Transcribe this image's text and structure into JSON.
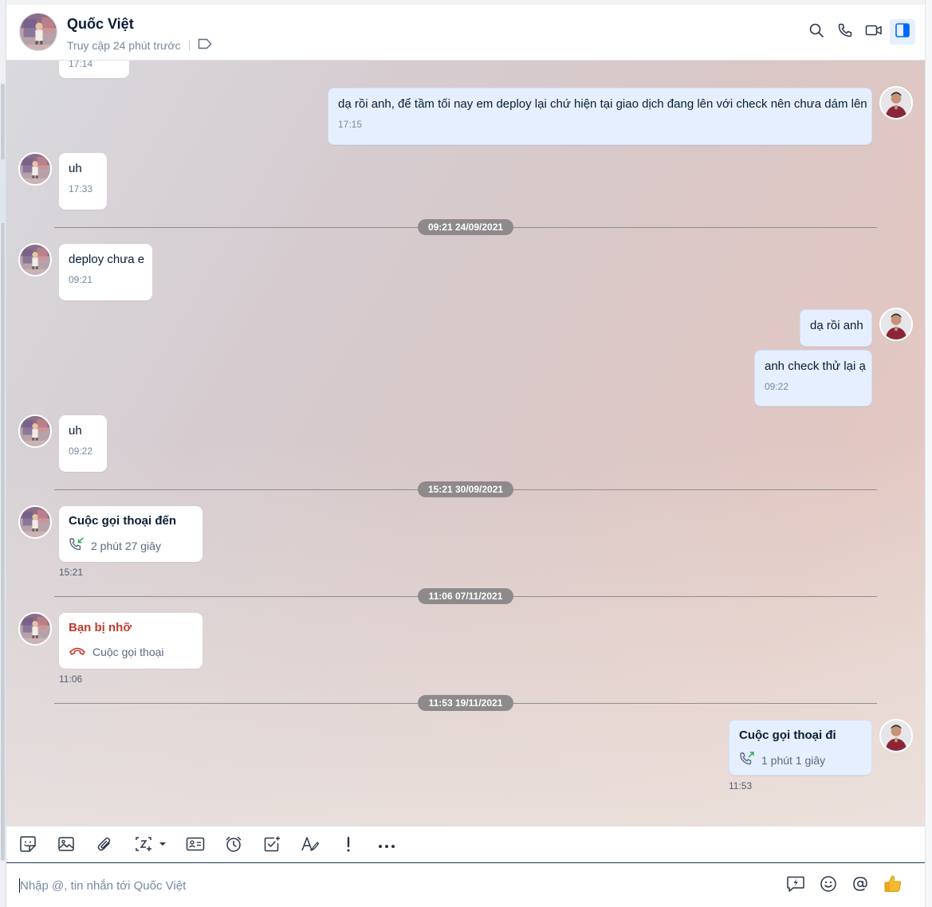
{
  "header": {
    "contact_name": "Quốc Việt",
    "status": "Truy cập 24 phút trước",
    "icons": [
      "tag-icon",
      "search-icon",
      "phone-icon",
      "video-icon",
      "sidebar-toggle-icon"
    ]
  },
  "messages": {
    "m0_time": "17:14",
    "m1_text": "dạ rồi anh, để tầm tối nay em deploy lại chứ hiện tại giao dịch đang lên với check nên chưa dám lên",
    "m1_time": "17:15",
    "m2_text": "uh",
    "m2_time": "17:33",
    "d1": "09:21 24/09/2021",
    "m3_text": "deploy chưa e",
    "m3_time": "09:21",
    "m4_text": "dạ rồi anh",
    "m5_text": "anh check thử lại ạ",
    "m5_time": "09:22",
    "m6_text": "uh",
    "m6_time": "09:22",
    "d2": "15:21 30/09/2021",
    "call1_title": "Cuộc gọi thoại đến",
    "call1_duration": "2 phút 27 giây",
    "call1_time": "15:21",
    "d3": "11:06 07/11/2021",
    "call2_title": "Bạn bị nhỡ",
    "call2_sub": "Cuộc gọi thoại",
    "call2_time": "11:06",
    "d4": "11:53 19/11/2021",
    "call3_title": "Cuộc gọi thoại đi",
    "call3_duration": "1 phút 1 giây",
    "call3_time": "11:53"
  },
  "toolbar": {
    "icons": [
      "sticker-icon",
      "image-icon",
      "attachment-icon",
      "screenshot-icon",
      "contact-card-icon",
      "reminder-icon",
      "task-icon",
      "format-text-icon",
      "urgent-icon",
      "more-icon"
    ]
  },
  "composer": {
    "placeholder": "Nhập @, tin nhắn tới Quốc Việt",
    "icons": [
      "quick-message-icon",
      "emoji-icon",
      "mention-icon",
      "thumbs-up-icon"
    ]
  },
  "colors": {
    "accent": "#0068ff",
    "outgoing_bubble": "#e5efff",
    "missed_call": "#c23a2f",
    "incoming_call_icon": "#2dab5d"
  }
}
